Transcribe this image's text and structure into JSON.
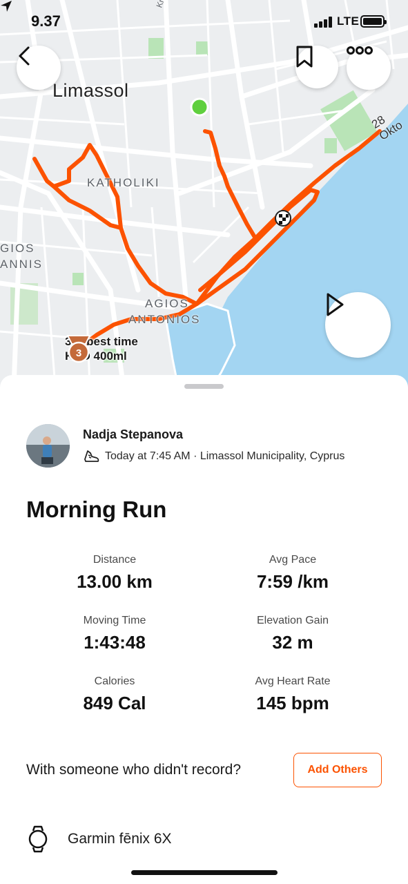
{
  "status_bar": {
    "time": "9.37",
    "network": "LTE"
  },
  "map": {
    "city": "Limassol",
    "district_labels": [
      "KATHOLIKI",
      "AGIOS",
      "ANTONIOS",
      "GIOS",
      "ANNIS"
    ],
    "street_label": "28 Okto",
    "road_label_top": "Kr",
    "segment_badge": {
      "rank": "3",
      "line1": "3rd best time",
      "line2": "KEO 400ml"
    },
    "colors": {
      "route": "#fc5200",
      "sea": "#a3d5f2",
      "park": "#b9e4b7",
      "start": "#5fcf3e"
    }
  },
  "athlete": {
    "name": "Nadja Stepanova",
    "meta": "Today at 7:45 AM · Limassol Municipality, Cyprus"
  },
  "activity": {
    "title": "Morning Run",
    "stats": [
      {
        "label": "Distance",
        "value": "13.00 km"
      },
      {
        "label": "Avg Pace",
        "value": "7:59 /km"
      },
      {
        "label": "Moving Time",
        "value": "1:43:48"
      },
      {
        "label": "Elevation Gain",
        "value": "32 m"
      },
      {
        "label": "Calories",
        "value": "849 Cal"
      },
      {
        "label": "Avg Heart Rate",
        "value": "145 bpm"
      }
    ]
  },
  "with_someone": {
    "prompt": "With someone who didn't record?",
    "button": "Add Others"
  },
  "device": {
    "name": "Garmin fēnix 6X",
    "icon": "watch-icon"
  },
  "accent": "#fc5200"
}
